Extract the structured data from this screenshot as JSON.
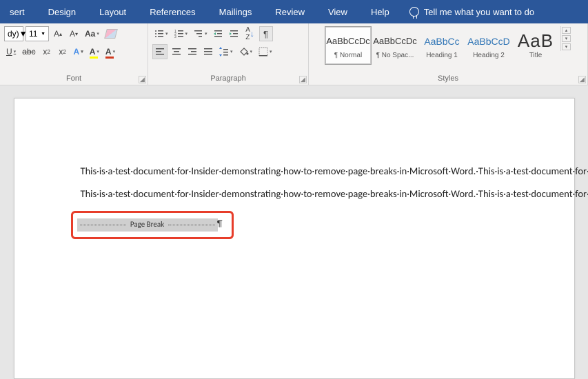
{
  "menu": {
    "items": [
      "sert",
      "Design",
      "Layout",
      "References",
      "Mailings",
      "Review",
      "View",
      "Help"
    ],
    "tellme": "Tell me what you want to do"
  },
  "groups": {
    "font": "Font",
    "paragraph": "Paragraph",
    "styles": "Styles"
  },
  "font": {
    "name_partial": "dy)",
    "size": "11"
  },
  "styles": [
    {
      "label": "¶ Normal",
      "preview": "AaBbCcDc",
      "cls": ""
    },
    {
      "label": "¶ No Spac...",
      "preview": "AaBbCcDc",
      "cls": ""
    },
    {
      "label": "Heading 1",
      "preview": "AaBbCc",
      "cls": "blue"
    },
    {
      "label": "Heading 2",
      "preview": "AaBbCcD",
      "cls": "blue"
    },
    {
      "label": "Title",
      "preview": "AaB",
      "cls": "big"
    }
  ],
  "document": {
    "paragraph": "This·is·a·test·document·for·Insider·demonstrating·how·to·remove·page·breaks·in·Microsoft·Word.·This·is·a·test·document·for·Insider·demonstrating·how·to·remove·page·breaks·in·Microsoft·Word.·This·is·a·test·document·for·Insider·demonstrating·how·to·remove·page·breaks·in·Microsoft·Word.·This·is·a·test·document·for·Insider·demonstrating·how·to·remove·page·breaks·in·Microsoft·Word.·This·is·a·test·document·for·Insider·demonstrating·how·to·remove·page·breaks·in·Microsoft·Word.¶",
    "pagebreak_label": "Page Break"
  }
}
